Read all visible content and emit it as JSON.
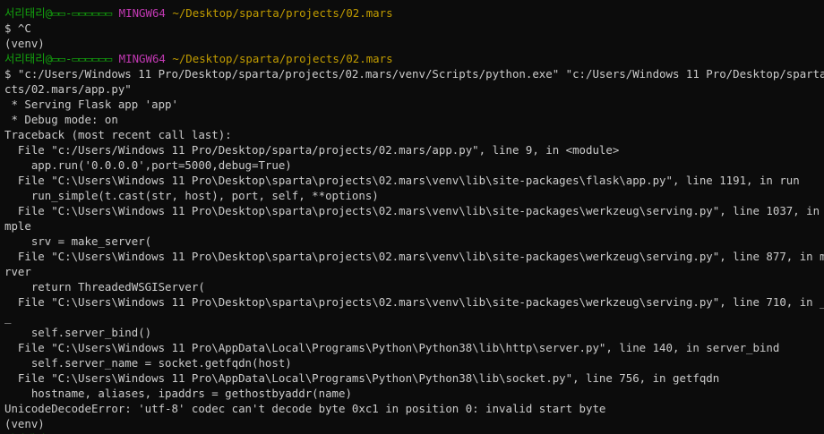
{
  "prompt": {
    "user": "서리태리@▭▭-▭▭▭▭▭▭",
    "env": "MINGW64",
    "path": "~/Desktop/sparta/projects/02.mars",
    "user_color": "#13a10e",
    "env_color": "#c239b3",
    "path_color": "#c19c00"
  },
  "lines": [
    "$ ^C",
    "(venv)",
    "$ \"c:/Users/Windows 11 Pro/Desktop/sparta/projects/02.mars/venv/Scripts/python.exe\" \"c:/Users/Windows 11 Pro/Desktop/sparta/proje",
    "cts/02.mars/app.py\"",
    " * Serving Flask app 'app'",
    " * Debug mode: on",
    "Traceback (most recent call last):",
    "  File \"c:/Users/Windows 11 Pro/Desktop/sparta/projects/02.mars/app.py\", line 9, in <module>",
    "    app.run('0.0.0.0',port=5000,debug=True)",
    "  File \"C:\\Users\\Windows 11 Pro\\Desktop\\sparta\\projects\\02.mars\\venv\\lib\\site-packages\\flask\\app.py\", line 1191, in run",
    "    run_simple(t.cast(str, host), port, self, **options)",
    "  File \"C:\\Users\\Windows 11 Pro\\Desktop\\sparta\\projects\\02.mars\\venv\\lib\\site-packages\\werkzeug\\serving.py\", line 1037, in run_si",
    "mple",
    "    srv = make_server(",
    "  File \"C:\\Users\\Windows 11 Pro\\Desktop\\sparta\\projects\\02.mars\\venv\\lib\\site-packages\\werkzeug\\serving.py\", line 877, in make_se",
    "rver",
    "    return ThreadedWSGIServer(",
    "  File \"C:\\Users\\Windows 11 Pro\\Desktop\\sparta\\projects\\02.mars\\venv\\lib\\site-packages\\werkzeug\\serving.py\", line 710, in __init_",
    "_",
    "    self.server_bind()",
    "  File \"C:\\Users\\Windows 11 Pro\\AppData\\Local\\Programs\\Python\\Python38\\lib\\http\\server.py\", line 140, in server_bind",
    "    self.server_name = socket.getfqdn(host)",
    "  File \"C:\\Users\\Windows 11 Pro\\AppData\\Local\\Programs\\Python\\Python38\\lib\\socket.py\", line 756, in getfqdn",
    "    hostname, aliases, ipaddrs = gethostbyaddr(name)",
    "UnicodeDecodeError: 'utf-8' codec can't decode byte 0xc1 in position 0: invalid start byte",
    "(venv)"
  ],
  "colors": {
    "background": "#0c0c0c",
    "text": "#cccccc"
  }
}
